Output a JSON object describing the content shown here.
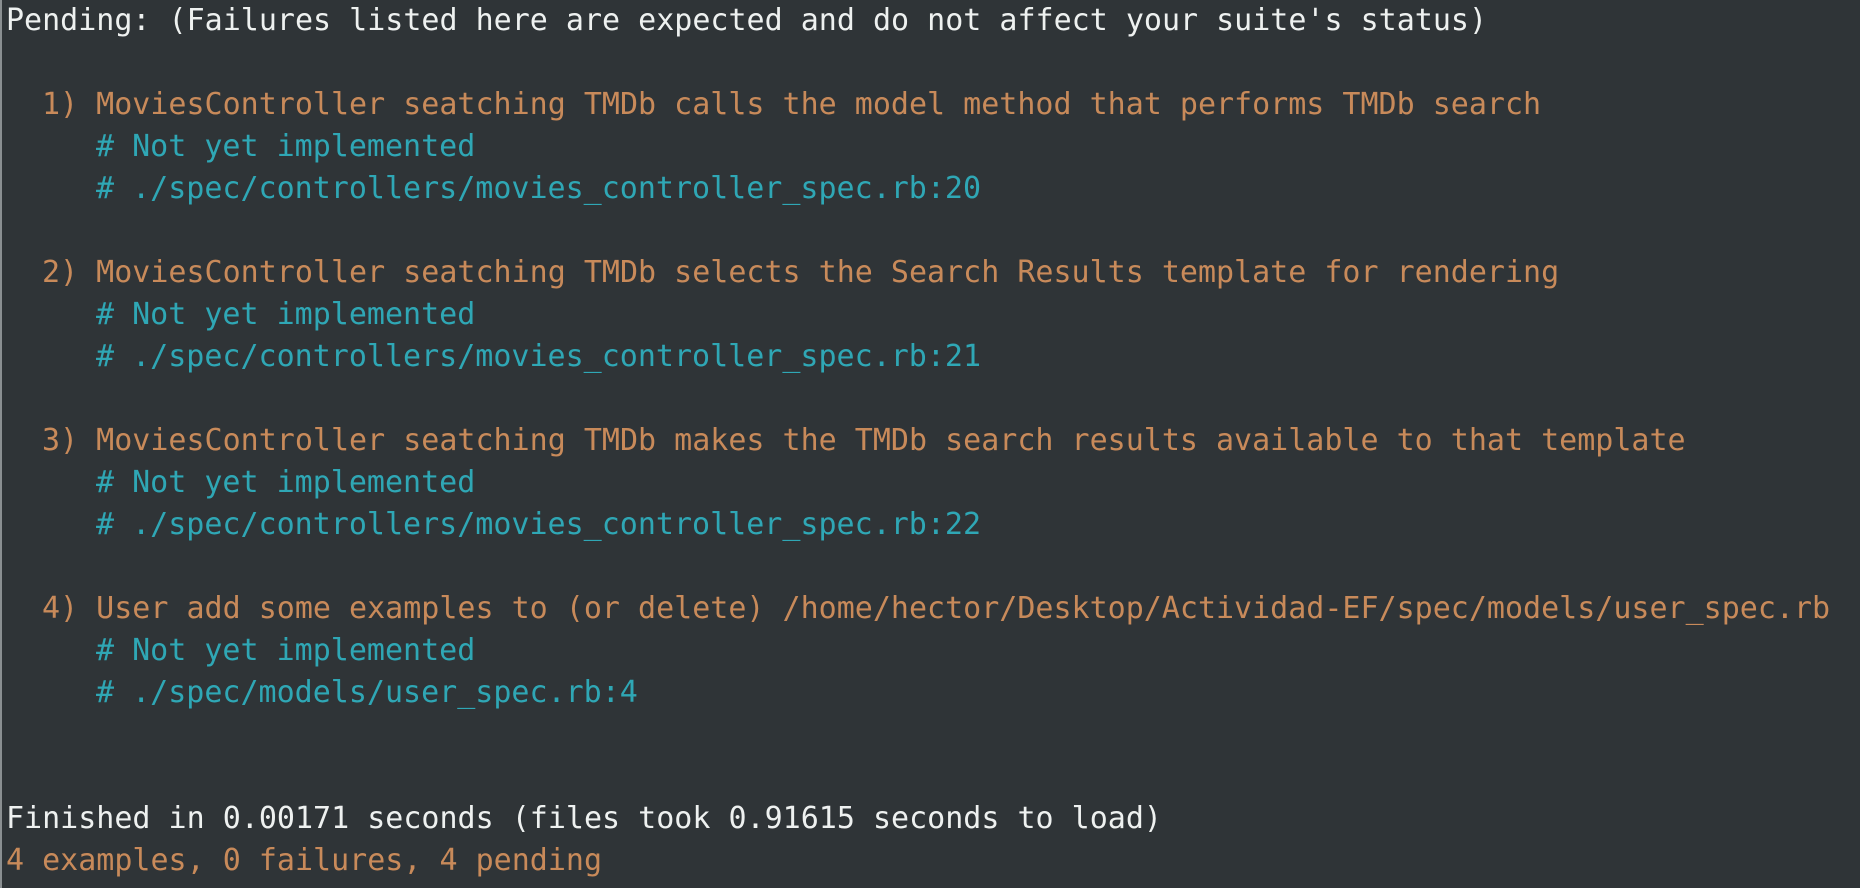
{
  "terminal": {
    "pending_header": "Pending: (Failures listed here are expected and do not affect your suite's status)",
    "items": [
      {
        "title": "1) MoviesController seatching TMDb calls the model method that performs TMDb search",
        "note": "# Not yet implemented",
        "location": "# ./spec/controllers/movies_controller_spec.rb:20"
      },
      {
        "title": "2) MoviesController seatching TMDb selects the Search Results template for rendering",
        "note": "# Not yet implemented",
        "location": "# ./spec/controllers/movies_controller_spec.rb:21"
      },
      {
        "title": "3) MoviesController seatching TMDb makes the TMDb search results available to that template",
        "note": "# Not yet implemented",
        "location": "# ./spec/controllers/movies_controller_spec.rb:22"
      },
      {
        "title": "4) User add some examples to (or delete) /home/hector/Desktop/Actividad-EF/spec/models/user_spec.rb",
        "note": "# Not yet implemented",
        "location": "# ./spec/models/user_spec.rb:4"
      }
    ],
    "finished_line": "Finished in 0.00171 seconds (files took 0.91615 seconds to load)",
    "summary_line": "4 examples, 0 failures, 4 pending"
  },
  "colors": {
    "background": "#2f3437",
    "text": "#eef1f0",
    "pending_item": "#c88a5a",
    "comment": "#2fa7b5"
  }
}
